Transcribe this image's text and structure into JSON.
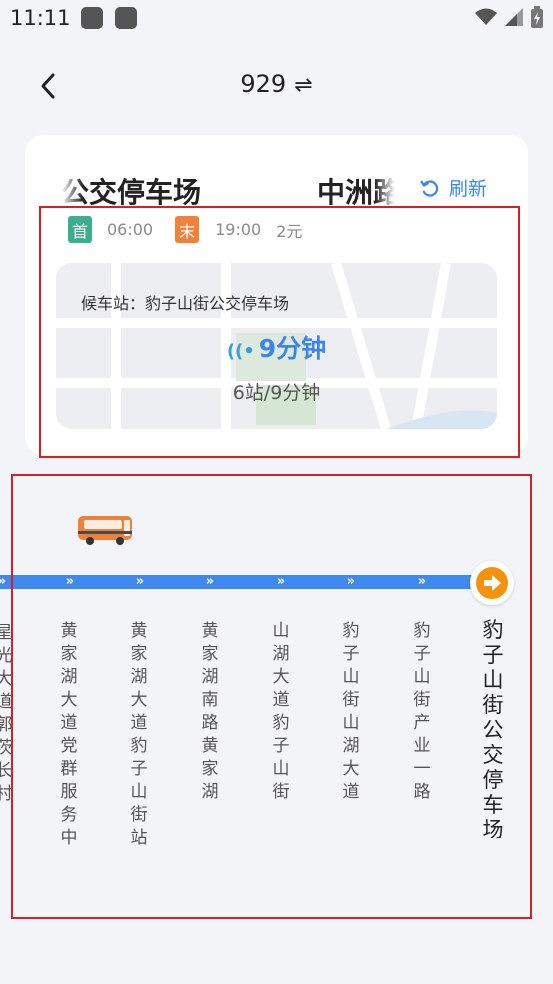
{
  "status_bar": {
    "time": "11:11"
  },
  "header": {
    "route": "929",
    "swap_symbol": "⇌"
  },
  "card": {
    "from_stop": "公交停车场",
    "to_stop": "中洲路",
    "refresh_label": "刷新",
    "first_tag": "首",
    "first_time": "06:00",
    "last_tag": "末",
    "last_time": "19:00",
    "fare": "2元",
    "waiting_label": "候车站：豹子山街公交停车场",
    "eta": "9分钟",
    "eta_detail": "6站/9分钟"
  },
  "route_line": {
    "chevron": "»",
    "stops": [
      "星光大道郭茨长村",
      "黄家湖大道党群服务中心",
      "黄家湖大道豹子山街站",
      "黄家湖南路黄家湖",
      "山湖大道豹子山街",
      "豹子山街山湖大道",
      "豹子山街产业一路",
      "豹子山街公交停车场"
    ]
  },
  "icons": {
    "back": "chevron-left-icon",
    "refresh": "refresh-icon",
    "bus": "bus-icon",
    "terminal": "arrow-right-circle-icon",
    "signal": "realtime-signal-icon"
  },
  "colors": {
    "accent": "#3b86e8",
    "first_tag": "#3dae8b",
    "last_tag": "#f0813a",
    "terminal": "#f5920c",
    "highlight_frame": "#d42027"
  }
}
